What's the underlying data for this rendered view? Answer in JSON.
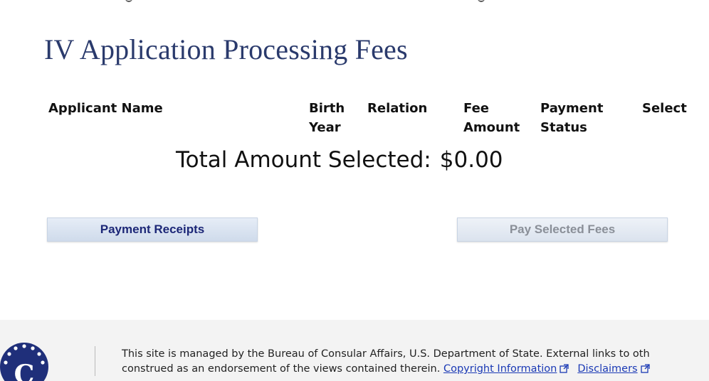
{
  "page": {
    "title": "IV Application Processing Fees"
  },
  "fee_table": {
    "headers": [
      {
        "label": "Applicant Name"
      },
      {
        "label": "Birth Year"
      },
      {
        "label": "Relation"
      },
      {
        "label": "Fee Amount"
      },
      {
        "label": "Payment Status"
      },
      {
        "label": "Select"
      }
    ],
    "rows": []
  },
  "total": {
    "label": "Total Amount Selected:",
    "amount": "$0.00"
  },
  "buttons": {
    "payment_receipts": "Payment Receipts",
    "pay_selected": "Pay Selected Fees"
  },
  "footer": {
    "line1": "This site is managed by the Bureau of Consular Affairs, U.S. Department of State. External links to oth",
    "line2": "construed as an endorsement of the views contained therein.",
    "copyright_link": "Copyright Information",
    "disclaimers_link": "Disclaimers",
    "seal_letter": "C"
  },
  "colors": {
    "title": "#2a3a6c",
    "link": "#1a39b5",
    "seal": "#1f2f7a"
  }
}
